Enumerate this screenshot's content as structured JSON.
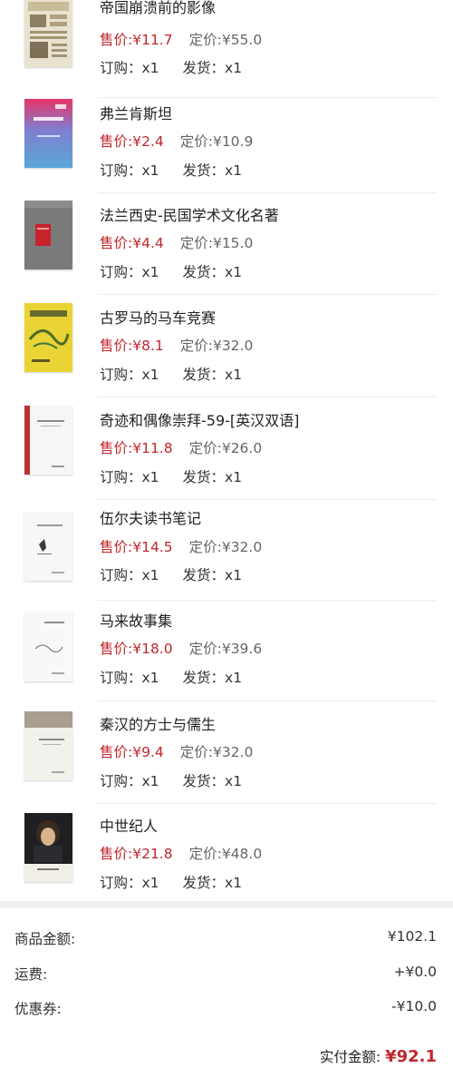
{
  "items": [
    {
      "title": "帝国崩溃前的影像",
      "sale": "售价:¥11.7",
      "list": "定价:¥55.0",
      "order": "订购：x1",
      "ship": "发货：x1"
    },
    {
      "title": "弗兰肯斯坦",
      "sale": "售价:¥2.4",
      "list": "定价:¥10.9",
      "order": "订购：x1",
      "ship": "发货：x1"
    },
    {
      "title": "法兰西史-民国学术文化名著",
      "sale": "售价:¥4.4",
      "list": "定价:¥15.0",
      "order": "订购：x1",
      "ship": "发货：x1"
    },
    {
      "title": "古罗马的马车竞赛",
      "sale": "售价:¥8.1",
      "list": "定价:¥32.0",
      "order": "订购：x1",
      "ship": "发货：x1"
    },
    {
      "title": "奇迹和偶像崇拜-59-[英汉双语]",
      "sale": "售价:¥11.8",
      "list": "定价:¥26.0",
      "order": "订购：x1",
      "ship": "发货：x1"
    },
    {
      "title": "伍尔夫读书笔记",
      "sale": "售价:¥14.5",
      "list": "定价:¥32.0",
      "order": "订购：x1",
      "ship": "发货：x1"
    },
    {
      "title": "马来故事集",
      "sale": "售价:¥18.0",
      "list": "定价:¥39.6",
      "order": "订购：x1",
      "ship": "发货：x1"
    },
    {
      "title": "秦汉的方士与儒生",
      "sale": "售价:¥9.4",
      "list": "定价:¥32.0",
      "order": "订购：x1",
      "ship": "发货：x1"
    },
    {
      "title": "中世纪人",
      "sale": "售价:¥21.8",
      "list": "定价:¥48.0",
      "order": "订购：x1",
      "ship": "发货：x1"
    }
  ],
  "summary": {
    "goods_label": "商品金额:",
    "goods_value": "¥102.1",
    "shipping_label": "运费:",
    "shipping_value": "+¥0.0",
    "coupon_label": "优惠券:",
    "coupon_value": "-¥10.0",
    "paid_label": "实付金额:",
    "paid_value": "¥92.1"
  },
  "colors": {
    "sale": "#c0272d",
    "accent": "#c0272d"
  }
}
